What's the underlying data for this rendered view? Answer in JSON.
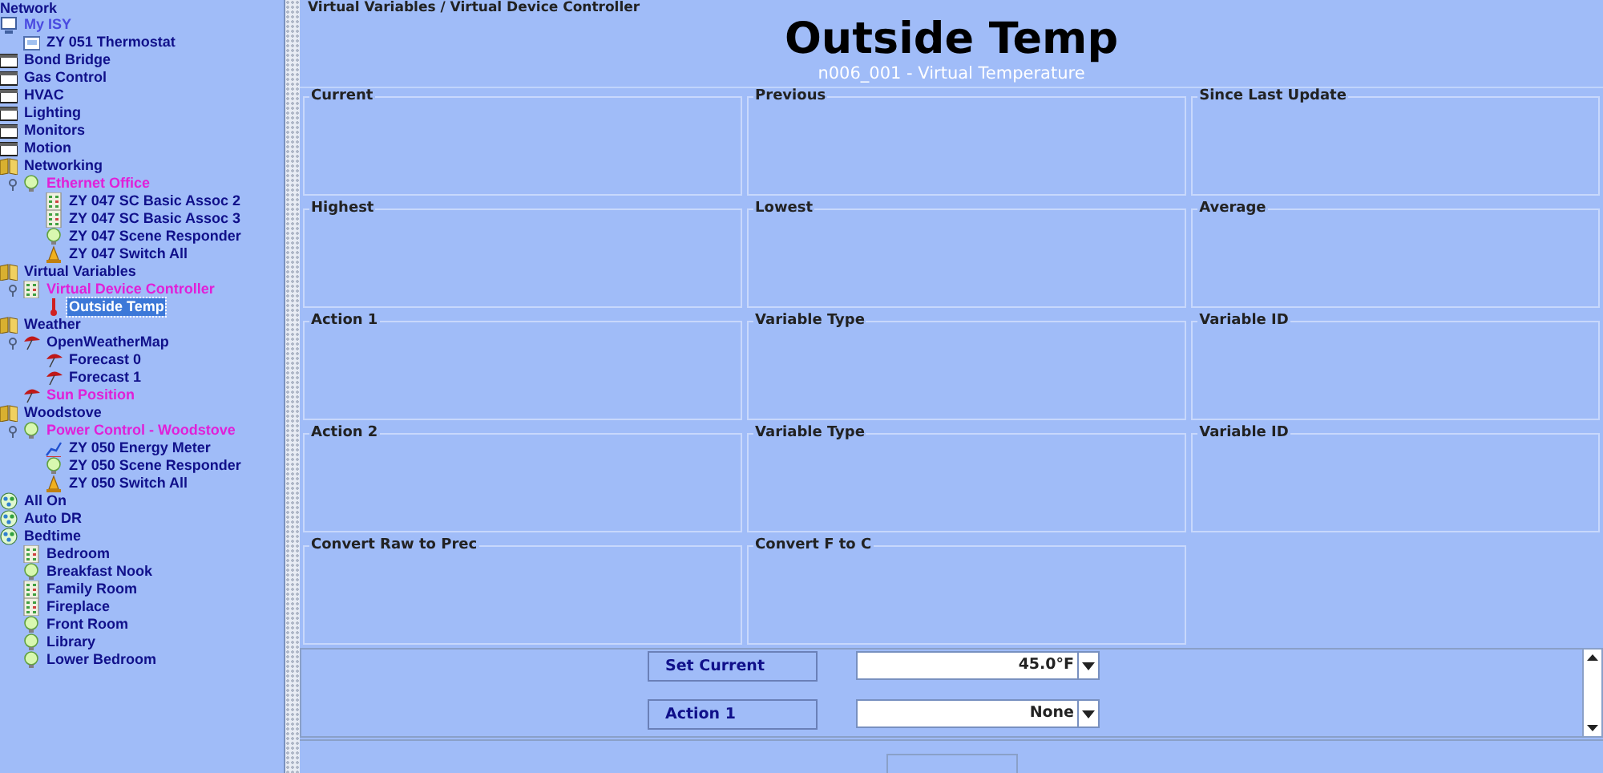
{
  "tree": {
    "root_label": "Network",
    "items": [
      {
        "label": "My ISY",
        "kind": "computer",
        "color": "#4a4ae0",
        "children": [
          {
            "label": "ZY 051 Thermostat",
            "kind": "thermostat",
            "color": "#10108a"
          }
        ]
      },
      {
        "label": "Bond Bridge",
        "kind": "folder",
        "color": "#10108a"
      },
      {
        "label": "Gas Control",
        "kind": "folder",
        "color": "#10108a"
      },
      {
        "label": "HVAC",
        "kind": "folder",
        "color": "#10108a"
      },
      {
        "label": "Lighting",
        "kind": "folder",
        "color": "#10108a"
      },
      {
        "label": "Monitors",
        "kind": "folder",
        "color": "#10108a"
      },
      {
        "label": "Motion",
        "kind": "folder",
        "color": "#10108a"
      },
      {
        "label": "Networking",
        "kind": "folder-open",
        "color": "#10108a",
        "children": [
          {
            "label": "Ethernet Office",
            "kind": "bulb",
            "color": "#e020d8",
            "expanded": true,
            "children": [
              {
                "label": "ZY 047 SC Basic Assoc 2",
                "kind": "keypad",
                "color": "#10108a"
              },
              {
                "label": "ZY 047 SC Basic Assoc 3",
                "kind": "keypad",
                "color": "#10108a"
              },
              {
                "label": "ZY 047 Scene Responder",
                "kind": "bulb",
                "color": "#10108a"
              },
              {
                "label": "ZY 047 Switch All",
                "kind": "bell",
                "color": "#10108a"
              }
            ]
          }
        ]
      },
      {
        "label": "Virtual Variables",
        "kind": "folder-open",
        "color": "#10108a",
        "children": [
          {
            "label": "Virtual Device Controller",
            "kind": "keypad",
            "color": "#e020d8",
            "expanded": true,
            "children": [
              {
                "label": "Outside Temp",
                "kind": "thermometer",
                "selected": true
              }
            ]
          }
        ]
      },
      {
        "label": "Weather",
        "kind": "folder-open",
        "color": "#10108a",
        "children": [
          {
            "label": "OpenWeatherMap",
            "kind": "umbrella",
            "color": "#10108a",
            "expanded": true,
            "children": [
              {
                "label": "Forecast 0",
                "kind": "umbrella",
                "color": "#10108a"
              },
              {
                "label": "Forecast 1",
                "kind": "umbrella",
                "color": "#10108a"
              }
            ]
          },
          {
            "label": "Sun Position",
            "kind": "umbrella",
            "color": "#e020d8"
          }
        ]
      },
      {
        "label": "Woodstove",
        "kind": "folder-open",
        "color": "#10108a",
        "children": [
          {
            "label": "Power Control - Woodstove",
            "kind": "bulb",
            "color": "#e020d8",
            "expanded": true,
            "children": [
              {
                "label": "ZY 050 Energy Meter",
                "kind": "meter",
                "color": "#10108a"
              },
              {
                "label": "ZY 050 Scene Responder",
                "kind": "bulb",
                "color": "#10108a"
              },
              {
                "label": "ZY 050 Switch All",
                "kind": "bell",
                "color": "#10108a"
              }
            ]
          }
        ]
      },
      {
        "label": "All On",
        "kind": "scene",
        "color": "#10108a"
      },
      {
        "label": "Auto DR",
        "kind": "scene",
        "color": "#10108a"
      },
      {
        "label": "Bedtime",
        "kind": "scene",
        "color": "#10108a",
        "children": [
          {
            "label": "Bedroom",
            "kind": "keypad",
            "color": "#10108a"
          },
          {
            "label": "Breakfast Nook",
            "kind": "bulb",
            "color": "#10108a"
          },
          {
            "label": "Family Room",
            "kind": "keypad",
            "color": "#10108a"
          },
          {
            "label": "Fireplace",
            "kind": "keypad",
            "color": "#10108a"
          },
          {
            "label": "Front Room",
            "kind": "bulb",
            "color": "#10108a"
          },
          {
            "label": "Library",
            "kind": "bulb",
            "color": "#10108a"
          },
          {
            "label": "Lower Bedroom",
            "kind": "bulb",
            "color": "#10108a"
          }
        ]
      }
    ]
  },
  "detail": {
    "breadcrumb": "Virtual Variables / Virtual Device Controller",
    "title": "Outside Temp",
    "subtitle": "n006_001 - Virtual Temperature",
    "panels": [
      {
        "label": "Current"
      },
      {
        "label": "Previous"
      },
      {
        "label": "Since Last Update"
      },
      {
        "label": "Highest"
      },
      {
        "label": "Lowest"
      },
      {
        "label": "Average"
      },
      {
        "label": "Action 1"
      },
      {
        "label": "Variable Type"
      },
      {
        "label": "Variable ID"
      },
      {
        "label": "Action 2"
      },
      {
        "label": "Variable Type"
      },
      {
        "label": "Variable ID"
      },
      {
        "label": "Convert Raw to Prec"
      },
      {
        "label": "Convert F to C"
      }
    ],
    "controls": [
      {
        "label": "Set Current",
        "value": "45.0°F"
      },
      {
        "label": "Action 1",
        "value": "None"
      }
    ]
  }
}
